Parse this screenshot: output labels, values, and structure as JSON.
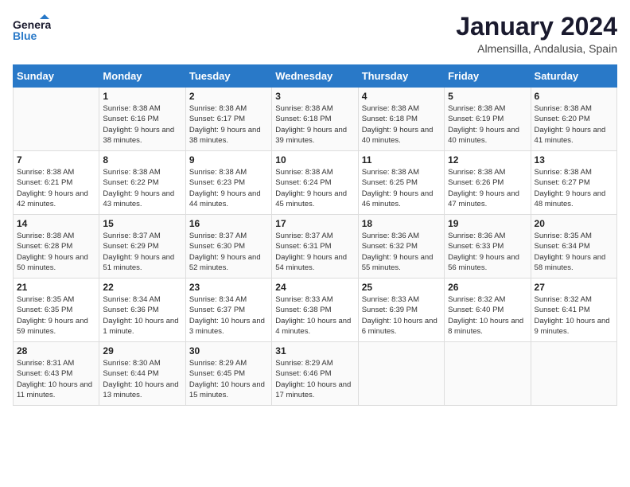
{
  "header": {
    "logo_general": "General",
    "logo_blue": "Blue",
    "title": "January 2024",
    "subtitle": "Almensilla, Andalusia, Spain"
  },
  "calendar": {
    "days_of_week": [
      "Sunday",
      "Monday",
      "Tuesday",
      "Wednesday",
      "Thursday",
      "Friday",
      "Saturday"
    ],
    "weeks": [
      [
        {
          "day": "",
          "sunrise": "",
          "sunset": "",
          "daylight": ""
        },
        {
          "day": "1",
          "sunrise": "Sunrise: 8:38 AM",
          "sunset": "Sunset: 6:16 PM",
          "daylight": "Daylight: 9 hours and 38 minutes."
        },
        {
          "day": "2",
          "sunrise": "Sunrise: 8:38 AM",
          "sunset": "Sunset: 6:17 PM",
          "daylight": "Daylight: 9 hours and 38 minutes."
        },
        {
          "day": "3",
          "sunrise": "Sunrise: 8:38 AM",
          "sunset": "Sunset: 6:18 PM",
          "daylight": "Daylight: 9 hours and 39 minutes."
        },
        {
          "day": "4",
          "sunrise": "Sunrise: 8:38 AM",
          "sunset": "Sunset: 6:18 PM",
          "daylight": "Daylight: 9 hours and 40 minutes."
        },
        {
          "day": "5",
          "sunrise": "Sunrise: 8:38 AM",
          "sunset": "Sunset: 6:19 PM",
          "daylight": "Daylight: 9 hours and 40 minutes."
        },
        {
          "day": "6",
          "sunrise": "Sunrise: 8:38 AM",
          "sunset": "Sunset: 6:20 PM",
          "daylight": "Daylight: 9 hours and 41 minutes."
        }
      ],
      [
        {
          "day": "7",
          "sunrise": "Sunrise: 8:38 AM",
          "sunset": "Sunset: 6:21 PM",
          "daylight": "Daylight: 9 hours and 42 minutes."
        },
        {
          "day": "8",
          "sunrise": "Sunrise: 8:38 AM",
          "sunset": "Sunset: 6:22 PM",
          "daylight": "Daylight: 9 hours and 43 minutes."
        },
        {
          "day": "9",
          "sunrise": "Sunrise: 8:38 AM",
          "sunset": "Sunset: 6:23 PM",
          "daylight": "Daylight: 9 hours and 44 minutes."
        },
        {
          "day": "10",
          "sunrise": "Sunrise: 8:38 AM",
          "sunset": "Sunset: 6:24 PM",
          "daylight": "Daylight: 9 hours and 45 minutes."
        },
        {
          "day": "11",
          "sunrise": "Sunrise: 8:38 AM",
          "sunset": "Sunset: 6:25 PM",
          "daylight": "Daylight: 9 hours and 46 minutes."
        },
        {
          "day": "12",
          "sunrise": "Sunrise: 8:38 AM",
          "sunset": "Sunset: 6:26 PM",
          "daylight": "Daylight: 9 hours and 47 minutes."
        },
        {
          "day": "13",
          "sunrise": "Sunrise: 8:38 AM",
          "sunset": "Sunset: 6:27 PM",
          "daylight": "Daylight: 9 hours and 48 minutes."
        }
      ],
      [
        {
          "day": "14",
          "sunrise": "Sunrise: 8:38 AM",
          "sunset": "Sunset: 6:28 PM",
          "daylight": "Daylight: 9 hours and 50 minutes."
        },
        {
          "day": "15",
          "sunrise": "Sunrise: 8:37 AM",
          "sunset": "Sunset: 6:29 PM",
          "daylight": "Daylight: 9 hours and 51 minutes."
        },
        {
          "day": "16",
          "sunrise": "Sunrise: 8:37 AM",
          "sunset": "Sunset: 6:30 PM",
          "daylight": "Daylight: 9 hours and 52 minutes."
        },
        {
          "day": "17",
          "sunrise": "Sunrise: 8:37 AM",
          "sunset": "Sunset: 6:31 PM",
          "daylight": "Daylight: 9 hours and 54 minutes."
        },
        {
          "day": "18",
          "sunrise": "Sunrise: 8:36 AM",
          "sunset": "Sunset: 6:32 PM",
          "daylight": "Daylight: 9 hours and 55 minutes."
        },
        {
          "day": "19",
          "sunrise": "Sunrise: 8:36 AM",
          "sunset": "Sunset: 6:33 PM",
          "daylight": "Daylight: 9 hours and 56 minutes."
        },
        {
          "day": "20",
          "sunrise": "Sunrise: 8:35 AM",
          "sunset": "Sunset: 6:34 PM",
          "daylight": "Daylight: 9 hours and 58 minutes."
        }
      ],
      [
        {
          "day": "21",
          "sunrise": "Sunrise: 8:35 AM",
          "sunset": "Sunset: 6:35 PM",
          "daylight": "Daylight: 9 hours and 59 minutes."
        },
        {
          "day": "22",
          "sunrise": "Sunrise: 8:34 AM",
          "sunset": "Sunset: 6:36 PM",
          "daylight": "Daylight: 10 hours and 1 minute."
        },
        {
          "day": "23",
          "sunrise": "Sunrise: 8:34 AM",
          "sunset": "Sunset: 6:37 PM",
          "daylight": "Daylight: 10 hours and 3 minutes."
        },
        {
          "day": "24",
          "sunrise": "Sunrise: 8:33 AM",
          "sunset": "Sunset: 6:38 PM",
          "daylight": "Daylight: 10 hours and 4 minutes."
        },
        {
          "day": "25",
          "sunrise": "Sunrise: 8:33 AM",
          "sunset": "Sunset: 6:39 PM",
          "daylight": "Daylight: 10 hours and 6 minutes."
        },
        {
          "day": "26",
          "sunrise": "Sunrise: 8:32 AM",
          "sunset": "Sunset: 6:40 PM",
          "daylight": "Daylight: 10 hours and 8 minutes."
        },
        {
          "day": "27",
          "sunrise": "Sunrise: 8:32 AM",
          "sunset": "Sunset: 6:41 PM",
          "daylight": "Daylight: 10 hours and 9 minutes."
        }
      ],
      [
        {
          "day": "28",
          "sunrise": "Sunrise: 8:31 AM",
          "sunset": "Sunset: 6:43 PM",
          "daylight": "Daylight: 10 hours and 11 minutes."
        },
        {
          "day": "29",
          "sunrise": "Sunrise: 8:30 AM",
          "sunset": "Sunset: 6:44 PM",
          "daylight": "Daylight: 10 hours and 13 minutes."
        },
        {
          "day": "30",
          "sunrise": "Sunrise: 8:29 AM",
          "sunset": "Sunset: 6:45 PM",
          "daylight": "Daylight: 10 hours and 15 minutes."
        },
        {
          "day": "31",
          "sunrise": "Sunrise: 8:29 AM",
          "sunset": "Sunset: 6:46 PM",
          "daylight": "Daylight: 10 hours and 17 minutes."
        },
        {
          "day": "",
          "sunrise": "",
          "sunset": "",
          "daylight": ""
        },
        {
          "day": "",
          "sunrise": "",
          "sunset": "",
          "daylight": ""
        },
        {
          "day": "",
          "sunrise": "",
          "sunset": "",
          "daylight": ""
        }
      ]
    ]
  }
}
